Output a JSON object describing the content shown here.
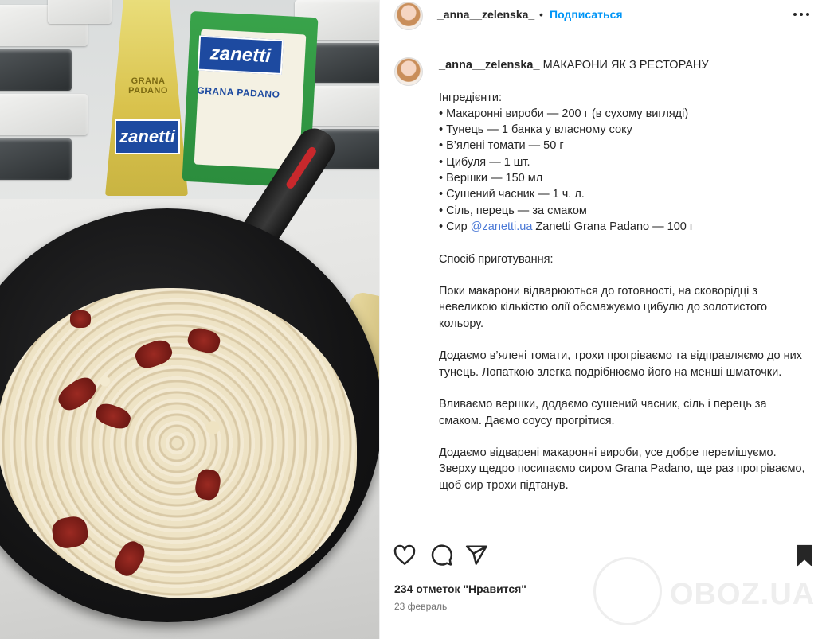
{
  "post_header": {
    "username": "_anna__zelenska_",
    "separator": "•",
    "follow_label": "Подписаться",
    "more_icon": "more-horizontal-icon"
  },
  "caption": {
    "username": "_anna__zelenska_",
    "title": " МАКАРОНИ ЯК З РЕСТОРАНУ",
    "ingredients_heading": "Інгредієнти:",
    "ingredients": [
      "• Макаронні вироби — 200 г (в сухому вигляді)",
      "• Тунець — 1 банка у власному соку",
      "• В’ялені томати — 50 г",
      "• Цибуля — 1 шт.",
      "• Вершки — 150 мл",
      "• Сушений часник — 1 ч. л.",
      "• Сіль, перець — за смаком"
    ],
    "cheese_prefix": "• Сир ",
    "cheese_mention": "@zanetti.ua",
    "cheese_suffix": " Zanetti Grana Padano — 100 г",
    "method_heading": "Спосіб приготування:",
    "steps": [
      "Поки макарони відварюються до готовності, на сковорідці з невеликою кількістю олії обсмажуємо цибулю до золотистого кольору.",
      "Додаємо в’ялені томати, трохи прогріваємо та відправляємо до них тунець. Лопаткою злегка подрібнюємо його на менші шматочки.",
      "Вливаємо вершки, додаємо сушений часник, сіль і перець за смаком. Даємо соусу прогрітися.",
      "Додаємо відварені макаронні вироби, усе добре перемішуємо. Зверху щедро посипаємо сиром Grana Padano, ще раз прогріваємо, щоб сир трохи підтанув."
    ]
  },
  "actions": {
    "like_icon": "heart-icon",
    "comment_icon": "comment-icon",
    "share_icon": "send-icon",
    "save_icon": "bookmark-icon",
    "likes_text": "234 отметок \"Нравится\"",
    "date_text": "23 февраль"
  },
  "photo": {
    "brand_logo": "zanetti",
    "product_label": "GRANA PADANO"
  },
  "watermark": {
    "text": "OBOZ.UA"
  },
  "colors": {
    "follow": "#0095f6",
    "mention": "#4b79d6",
    "text": "#262626",
    "muted": "#737373"
  }
}
